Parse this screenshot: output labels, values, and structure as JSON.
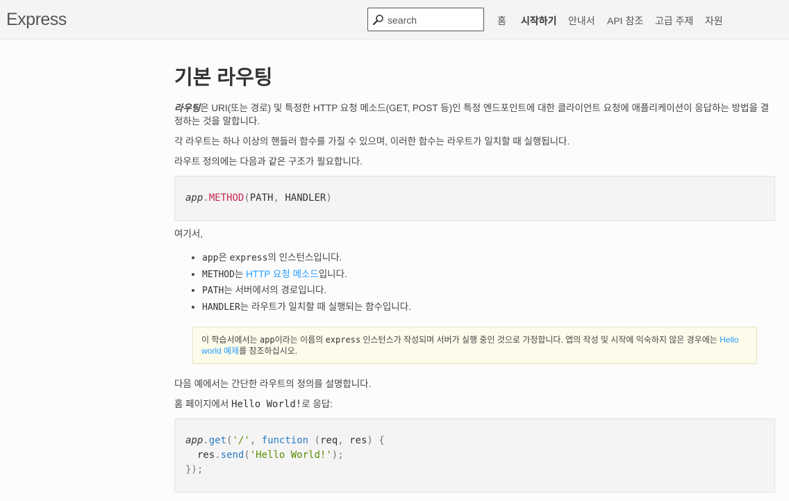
{
  "header": {
    "logo": "Express",
    "search_placeholder": "search",
    "nav": [
      {
        "label": "홈"
      },
      {
        "label": "시작하기"
      },
      {
        "label": "안내서"
      },
      {
        "label": "API 참조"
      },
      {
        "label": "고급 주제"
      },
      {
        "label": "자원"
      }
    ]
  },
  "main": {
    "title": "기본 라우팅",
    "intro": {
      "term": "라우팅",
      "text": "은 URI(또는 경로) 및 특정한 HTTP 요청 메소드(GET, POST 등)인 특정 엔드포인트에 대한 클라이언트 요청에 애플리케이션이 응답하는 방법을 결정하는 것을 말합니다."
    },
    "p2": "각 라우트는 하나 이상의 핸들러 함수를 가질 수 있으며, 이러한 함수는 라우트가 일치할 때 실행됩니다.",
    "p3": "라우트 정의에는 다음과 같은 구조가 필요합니다.",
    "code1": {
      "app": "app",
      "dot": ".",
      "method": "METHOD",
      "open": "(",
      "path": "PATH",
      "comma": ",",
      "handler": "HANDLER",
      "close": ")"
    },
    "where": "여기서,",
    "bullets": [
      {
        "code": "app",
        "text": "은 "
      },
      {
        "code": "METHOD",
        "text": "는 "
      },
      {
        "code": "PATH",
        "text": "는 서버에서의 경로입니다."
      },
      {
        "code": "HANDLER",
        "text": "는 라우트가 일치할 때 실행되는 함수입니다."
      }
    ],
    "bullet1_code2": "express",
    "bullet1_tail": "의 인스턴스입니다.",
    "bullet2_link": "HTTP 요청 메소드",
    "bullet2_tail": "입니다.",
    "note": {
      "t1": "이 학습서에서는 ",
      "c1": "app",
      "t2": "이라는 이름의 ",
      "c2": "express",
      "t3": " 인스턴스가 작성되며 서버가 실행 중인 것으로 가정합니다. 앱의 작성 및 시작에 익숙하지 않은 경우에는 ",
      "link": "Hello world 예제",
      "t4": "를 참조하십시오."
    },
    "p4": "다음 예에서는 간단한 라우트의 정의를 설명합니다.",
    "p5_pre": "홈 페이지에서 ",
    "p5_code": "Hello World!",
    "p5_post": "로 응답:",
    "code2": {
      "l1_app": "app",
      "l1_dot": ".",
      "l1_get": "get",
      "l1_open": "(",
      "l1_str": "'/'",
      "l1_comma": ",",
      "l1_fn": "function",
      "l1_params_open": "(",
      "l1_req": "req",
      "l1_comma2": ",",
      "l1_res": "res",
      "l1_params_close": ")",
      "l1_brace": "{",
      "l2_res": "res",
      "l2_dot": ".",
      "l2_send": "send",
      "l2_open": "(",
      "l2_str": "'Hello World!'",
      "l2_close": ");",
      "l3": "});"
    },
    "colors": {
      "link": "#259dff",
      "code_red": "#c7254e",
      "code_blue": "#2a7cc2",
      "code_green": "#5a8c00"
    }
  }
}
